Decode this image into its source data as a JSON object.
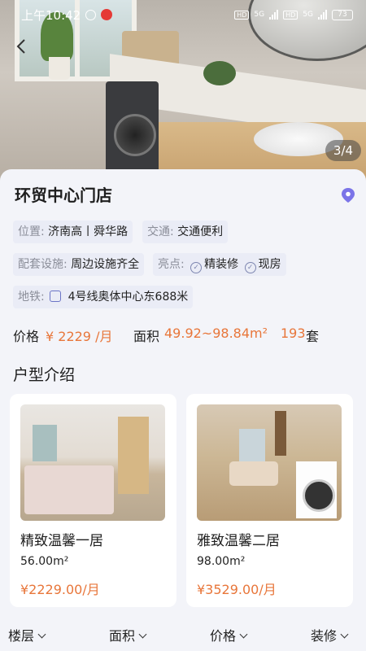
{
  "status_bar": {
    "time": "上午10:42",
    "network_5g_1": "5G",
    "network_5g_2": "5G",
    "hd_1": "HD",
    "hd_2": "HD",
    "battery": "73"
  },
  "gallery": {
    "pager": "3/4"
  },
  "store": {
    "title": "环贸中心门店"
  },
  "info": {
    "location_label": "位置:",
    "location_value": "济南高丨舜华路",
    "traffic_label": "交通:",
    "traffic_value": "交通便利",
    "facilities_label": "配套设施:",
    "facilities_value": "周边设施齐全",
    "highlights_label": "亮点:",
    "highlight_1": "精装修",
    "highlight_2": "现房",
    "metro_label": "地铁:",
    "metro_value": "4号线奥体中心东688米"
  },
  "summary": {
    "price_label": "价格",
    "price_value": "¥ 2229 /月",
    "area_label": "面积",
    "area_value": "49.92~98.84m²",
    "count_value": "193",
    "count_unit": "套"
  },
  "layouts": {
    "section_title": "户型介绍",
    "cards": [
      {
        "name": "精致温馨一居",
        "area": "56.00m²",
        "price": "¥2229.00/月"
      },
      {
        "name": "雅致温馨二居",
        "area": "98.00m²",
        "price": "¥3529.00/月"
      }
    ]
  },
  "filters": [
    "楼层",
    "面积",
    "价格",
    "装修"
  ],
  "colors": {
    "accent_orange": "#e8763a",
    "pin_purple": "#7b74e8"
  }
}
